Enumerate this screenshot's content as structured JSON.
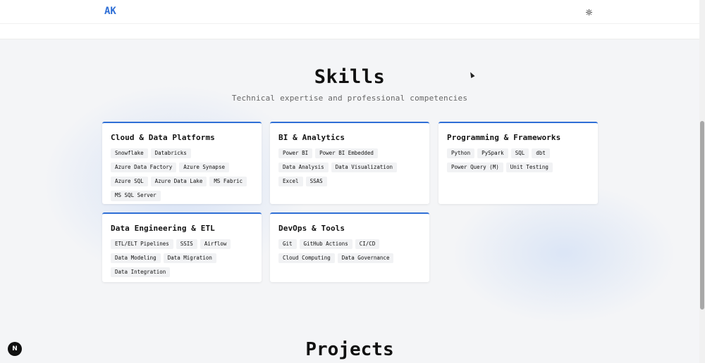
{
  "header": {
    "logo": "AK",
    "theme_icon": "sun-icon"
  },
  "skills": {
    "title": "Skills",
    "subtitle": "Technical expertise and professional competencies",
    "categories": [
      {
        "title": "Cloud & Data Platforms",
        "tags": [
          "Snowflake",
          "Databricks",
          "Azure Data Factory",
          "Azure Synapse",
          "Azure SQL",
          "Azure Data Lake",
          "MS Fabric",
          "MS SQL Server"
        ]
      },
      {
        "title": "BI & Analytics",
        "tags": [
          "Power BI",
          "Power BI Embedded",
          "Data Analysis",
          "Data Visualization",
          "Excel",
          "SSAS"
        ]
      },
      {
        "title": "Programming & Frameworks",
        "tags": [
          "Python",
          "PySpark",
          "SQL",
          "dbt",
          "Power Query (M)",
          "Unit Testing"
        ]
      },
      {
        "title": "Data Engineering & ETL",
        "tags": [
          "ETL/ELT Pipelines",
          "SSIS",
          "Airflow",
          "Data Modeling",
          "Data Migration",
          "Data Integration"
        ]
      },
      {
        "title": "DevOps & Tools",
        "tags": [
          "Git",
          "GitHub Actions",
          "CI/CD",
          "Cloud Computing",
          "Data Governance"
        ]
      }
    ]
  },
  "projects": {
    "title": "Projects"
  },
  "dev_badge": {
    "label": "N"
  },
  "colors": {
    "accent": "#2f6fd6",
    "background": "#f4f5f7",
    "card": "#ffffff",
    "tag_bg": "#f1f2f4"
  }
}
